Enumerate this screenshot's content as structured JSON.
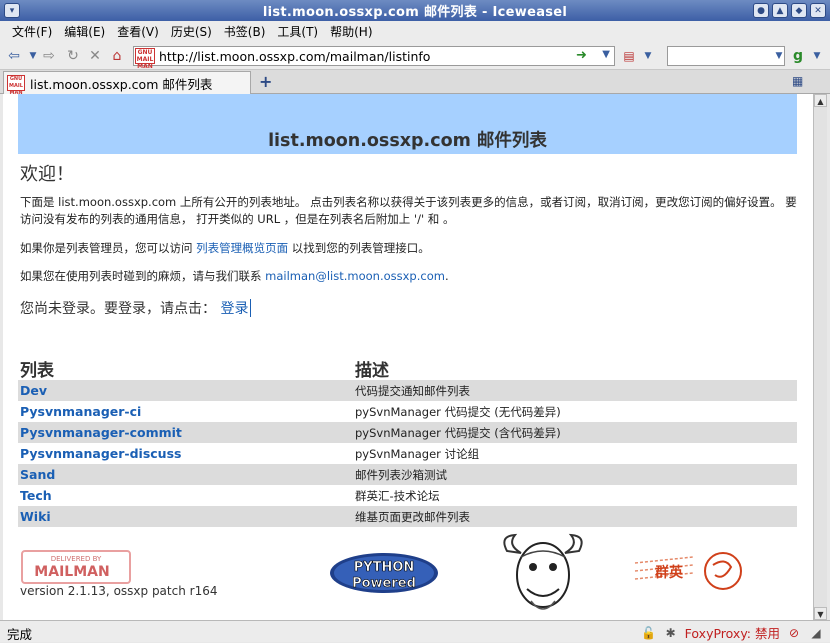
{
  "window": {
    "title": "list.moon.ossxp.com 邮件列表 - Iceweasel"
  },
  "menu": [
    "文件(F)",
    "编辑(E)",
    "查看(V)",
    "历史(S)",
    "书签(B)",
    "工具(T)",
    "帮助(H)"
  ],
  "nav": {
    "url": "http://list.moon.ossxp.com/mailman/listinfo",
    "search_placeholder": ""
  },
  "tab": {
    "label": "list.moon.ossxp.com 邮件列表",
    "new_tab": "+"
  },
  "page": {
    "banner_title": "list.moon.ossxp.com 邮件列表",
    "welcome": "欢迎！",
    "intro": "下面是 list.moon.ossxp.com 上所有公开的列表地址。 点击列表名称以获得关于该列表更多的信息，或者订阅，取消订阅，更改您订阅的偏好设置。 要访问没有发布的列表的通用信息， 打开类似的 URL ，但是在列表名后附加上 '/' 和 。",
    "admin_prefix": "如果你是列表管理员，您可以访问 ",
    "admin_link": "列表管理概览页面",
    "admin_suffix": " 以找到您的列表管理接口。",
    "contact_prefix": "如果您在使用列表时碰到的麻烦，请与我们联系 ",
    "contact_email": "mailman@list.moon.ossxp.com",
    "contact_suffix": ".",
    "login_prompt": "您尚未登录。要登录，请点击： ",
    "login_link": "登录",
    "col_list": "列表",
    "col_desc": "描述",
    "lists": [
      {
        "name": "Dev",
        "desc": "代码提交通知邮件列表"
      },
      {
        "name": "Pysvnmanager-ci",
        "desc": "pySvnManager 代码提交 (无代码差异)"
      },
      {
        "name": "Pysvnmanager-commit",
        "desc": "pySvnManager 代码提交 (含代码差异)"
      },
      {
        "name": "Pysvnmanager-discuss",
        "desc": "pySvnManager 讨论组"
      },
      {
        "name": "Sand",
        "desc": "邮件列表沙箱测试"
      },
      {
        "name": "Tech",
        "desc": "群英汇-技术论坛"
      },
      {
        "name": "Wiki",
        "desc": "维基页面更改邮件列表"
      }
    ],
    "version": "version 2.1.13, ossxp patch r164",
    "logo_mailman_top": "DELIVERED BY",
    "logo_mailman_main": "MAILMAN",
    "logo_python_top": "PYTHON",
    "logo_python_bottom": "Powered",
    "logo_stamp_text": "群英"
  },
  "status": {
    "text": "完成",
    "proxy": "FoxyProxy: 禁用"
  },
  "colors": {
    "banner": "#a6d0ff",
    "link": "#1a5fb4",
    "row_alt": "#dcdcdc",
    "titlebar": "#3d5fa6"
  }
}
